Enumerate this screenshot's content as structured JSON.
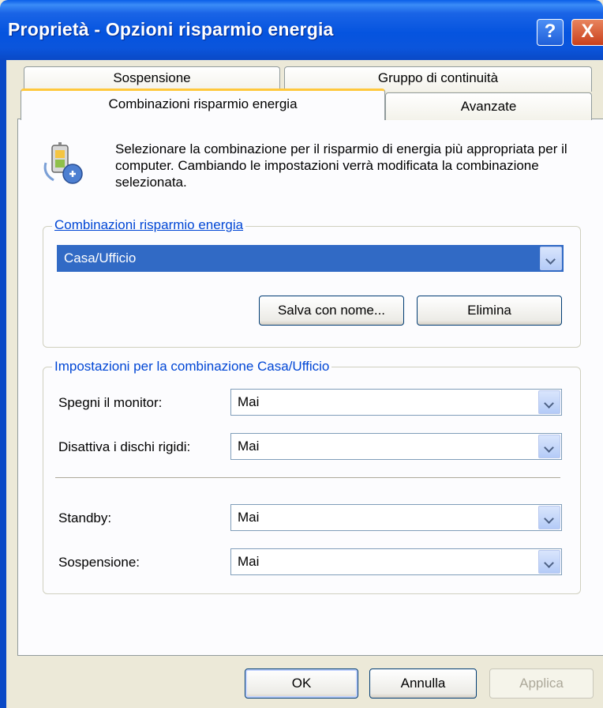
{
  "window": {
    "title": "Proprietà - Opzioni risparmio energia",
    "help_glyph": "?",
    "close_glyph": "X"
  },
  "tabs": {
    "row1": [
      "Sospensione",
      "Gruppo di continuità"
    ],
    "row2": [
      "Combinazioni risparmio energia",
      "Avanzate"
    ],
    "active": "Combinazioni risparmio energia"
  },
  "intro": {
    "icon": "power-options-icon",
    "text": "Selezionare la combinazione per il risparmio di energia più appropriata per il computer. Cambiando le impostazioni verrà modificata la combinazione selezionata."
  },
  "schemes": {
    "group_label": "Combinazioni risparmio energia",
    "selected": "Casa/Ufficio",
    "save_as_label": "Salva con nome...",
    "delete_label": "Elimina"
  },
  "settings": {
    "group_label": "Impostazioni per la combinazione Casa/Ufficio",
    "monitor_label": "Spegni il monitor:",
    "monitor_value": "Mai",
    "disks_label": "Disattiva i dischi rigidi:",
    "disks_value": "Mai",
    "standby_label": "Standby:",
    "standby_value": "Mai",
    "hibernate_label": "Sospensione:",
    "hibernate_value": "Mai"
  },
  "footer": {
    "ok_label": "OK",
    "cancel_label": "Annulla",
    "apply_label": "Applica"
  },
  "colors": {
    "titlebar": "#0a5ee8",
    "selection": "#316ac5",
    "group_label": "#0046d5"
  }
}
